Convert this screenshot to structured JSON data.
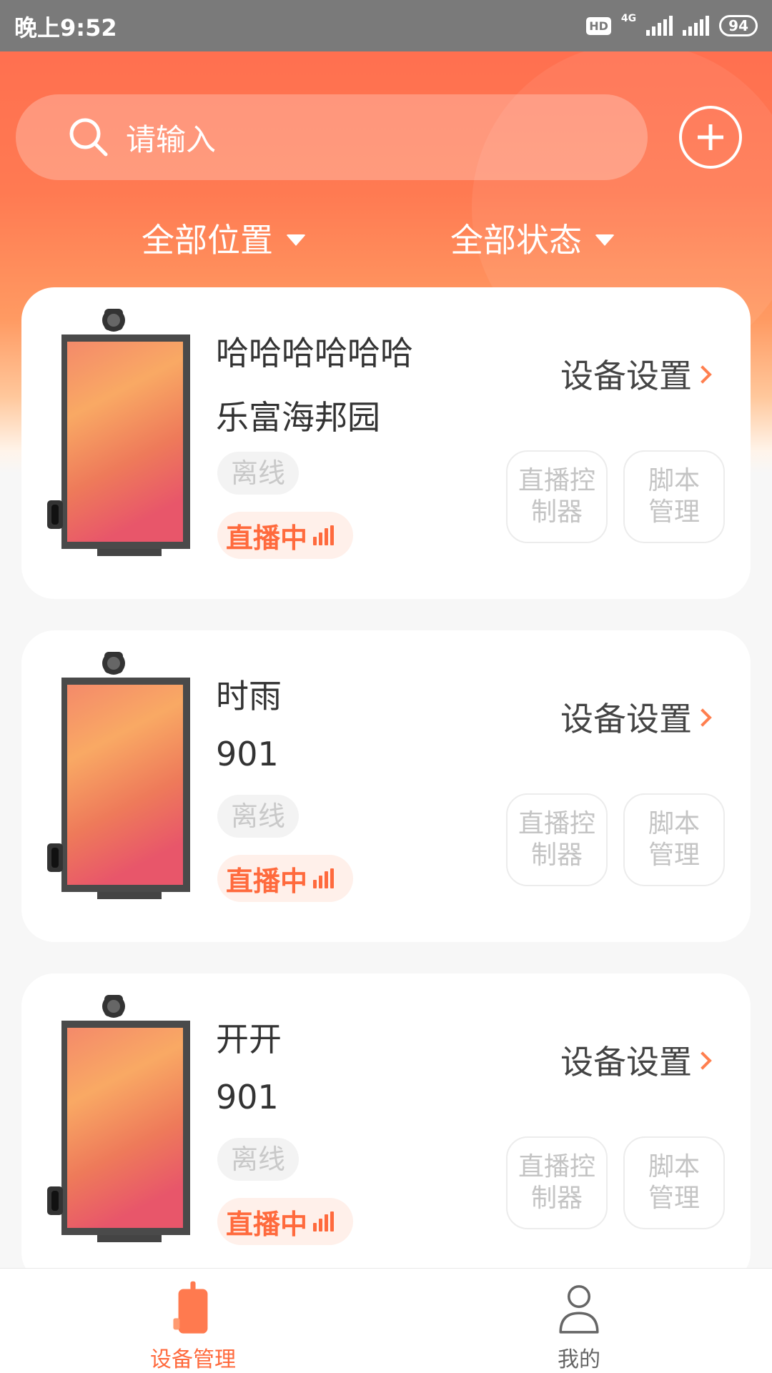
{
  "status_bar": {
    "time": "晚上9:52",
    "hd": "HD",
    "network": "4G",
    "battery": "94"
  },
  "search": {
    "placeholder": "请输入"
  },
  "filters": {
    "location": "全部位置",
    "status": "全部状态"
  },
  "devices": [
    {
      "name": "哈哈哈哈哈哈",
      "location": "乐富海邦园",
      "offline_tag": "离线",
      "live_tag": "直播中",
      "settings_label": "设备设置",
      "live_control": [
        "直播控",
        "制器"
      ],
      "script_manage": [
        "脚本",
        "管理"
      ]
    },
    {
      "name": "时雨",
      "location": "901",
      "offline_tag": "离线",
      "live_tag": "直播中",
      "settings_label": "设备设置",
      "live_control": [
        "直播控",
        "制器"
      ],
      "script_manage": [
        "脚本",
        "管理"
      ]
    },
    {
      "name": "开开",
      "location": "901",
      "offline_tag": "离线",
      "live_tag": "直播中",
      "settings_label": "设备设置",
      "live_control": [
        "直播控",
        "制器"
      ],
      "script_manage": [
        "脚本",
        "管理"
      ]
    }
  ],
  "bottom_nav": [
    {
      "label": "设备管理",
      "icon": "device-icon",
      "active": true
    },
    {
      "label": "我的",
      "icon": "user-icon",
      "active": false
    }
  ],
  "colors": {
    "accent": "#ff6a3d",
    "header_top": "#ff6c4f",
    "inactive_text": "#c4c4c4"
  }
}
